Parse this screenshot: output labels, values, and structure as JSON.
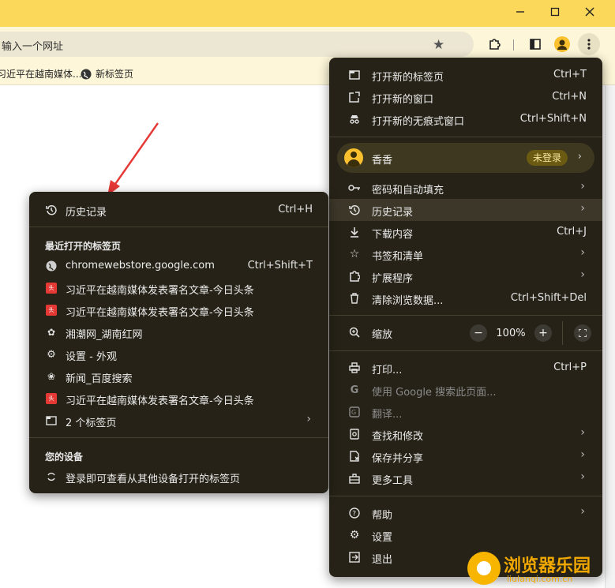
{
  "address_bar": {
    "text": "输入一个网址"
  },
  "bookmarks": [
    {
      "label": "习近平在越南媒体...",
      "icon": "toutiao-favicon"
    },
    {
      "label": "新标签页",
      "icon": "globe-icon"
    }
  ],
  "main_menu": {
    "group1": [
      {
        "label": "打开新的标签页",
        "shortcut": "Ctrl+T",
        "icon": "new-tab-icon"
      },
      {
        "label": "打开新的窗口",
        "shortcut": "Ctrl+N",
        "icon": "new-window-icon"
      },
      {
        "label": "打开新的无痕式窗口",
        "shortcut": "Ctrl+Shift+N",
        "icon": "incognito-icon"
      }
    ],
    "profile": {
      "name": "香香",
      "status": "未登录"
    },
    "group2": [
      {
        "label": "密码和自动填充",
        "icon": "key-icon"
      },
      {
        "label": "历史记录",
        "icon": "history-icon"
      },
      {
        "label": "下载内容",
        "shortcut": "Ctrl+J",
        "icon": "download-icon"
      },
      {
        "label": "书签和清单",
        "icon": "star-icon"
      },
      {
        "label": "扩展程序",
        "icon": "puzzle-icon"
      },
      {
        "label": "清除浏览数据...",
        "shortcut": "Ctrl+Shift+Del",
        "icon": "trash-icon"
      }
    ],
    "zoom": {
      "label": "缩放",
      "value": "100%"
    },
    "group3": [
      {
        "label": "打印...",
        "shortcut": "Ctrl+P",
        "icon": "print-icon"
      },
      {
        "label": "使用 Google 搜索此页面...",
        "icon": "google-icon"
      },
      {
        "label": "翻译...",
        "icon": "translate-icon"
      },
      {
        "label": "查找和修改",
        "icon": "find-icon"
      },
      {
        "label": "保存并分享",
        "icon": "save-share-icon"
      },
      {
        "label": "更多工具",
        "icon": "toolbox-icon"
      }
    ],
    "group4": [
      {
        "label": "帮助",
        "icon": "help-icon"
      },
      {
        "label": "设置",
        "icon": "gear-icon"
      },
      {
        "label": "退出",
        "icon": "exit-icon"
      }
    ]
  },
  "history_menu": {
    "history": {
      "label": "历史记录",
      "shortcut": "Ctrl+H"
    },
    "recent_title": "最近打开的标签页",
    "recent": [
      {
        "label": "chromewebstore.google.com",
        "shortcut": "Ctrl+Shift+T",
        "icon": "globe-icon"
      },
      {
        "label": "习近平在越南媒体发表署名文章-今日头条",
        "icon": "toutiao-favicon"
      },
      {
        "label": "习近平在越南媒体发表署名文章-今日头条",
        "icon": "toutiao-favicon"
      },
      {
        "label": "湘潮网_湖南红网",
        "icon": "xiangchao-favicon"
      },
      {
        "label": "设置 - 外观",
        "icon": "settings-favicon"
      },
      {
        "label": "新闻_百度搜索",
        "icon": "baidu-favicon"
      },
      {
        "label": "习近平在越南媒体发表署名文章-今日头条",
        "icon": "toutiao-favicon"
      }
    ],
    "tab_group": {
      "label": "2 个标签页"
    },
    "devices_title": "您的设备",
    "devices_item": "登录即可查看从其他设备打开的标签页"
  },
  "watermark": {
    "title": "浏览器乐园",
    "url": "liulanqi.com.cn"
  },
  "colors": {
    "titlebar": "#fbd75a",
    "menu_bg": "#262217",
    "highlight": "#3c3729",
    "arrow": "#e53935"
  }
}
